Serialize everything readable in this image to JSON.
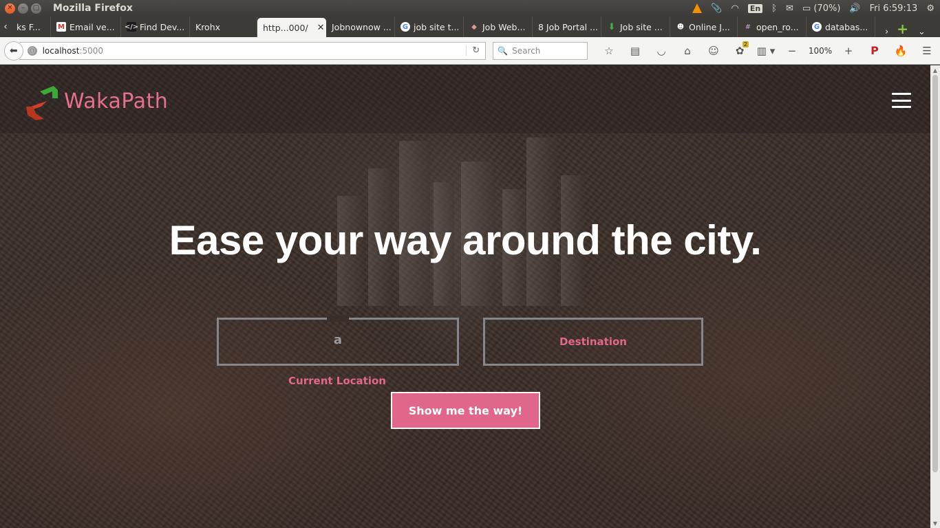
{
  "os": {
    "title": "Mozilla Firefox",
    "tray": {
      "lang": "En",
      "battery": "(70%)",
      "clock": "Fri  6:59:13"
    }
  },
  "tabs": [
    {
      "label": "ks F...",
      "icon": ""
    },
    {
      "label": "Email ve...",
      "icon": "gmail-icon"
    },
    {
      "label": "Find Dev...",
      "icon": "code-icon"
    },
    {
      "label": "Krohx",
      "icon": ""
    },
    {
      "label": "http...000/",
      "icon": "",
      "active": true
    },
    {
      "label": "Jobnownow ...",
      "icon": ""
    },
    {
      "label": "job site t...",
      "icon": "google-icon"
    },
    {
      "label": "Job Web...",
      "icon": "job-icon"
    },
    {
      "label": "8 Job Portal ...",
      "icon": ""
    },
    {
      "label": "Job site ...",
      "icon": "download-icon"
    },
    {
      "label": "Online J...",
      "icon": "owl-icon"
    },
    {
      "label": "open_ro...",
      "icon": "hash-icon"
    },
    {
      "label": "databas...",
      "icon": "google-icon"
    }
  ],
  "nav": {
    "url_host": "localhost",
    "url_port": ":5000",
    "search_placeholder": "Search",
    "zoom": "100%",
    "badge_count": "2"
  },
  "page": {
    "brand": "WakaPath",
    "hero_title": "Ease your way around the city.",
    "current_location_value": "a",
    "current_location_label": "Current Location",
    "destination_placeholder": "Destination",
    "cta_label": "Show me the way!"
  },
  "colors": {
    "accent": "#e0668a",
    "field_border": "#86868d",
    "logo_green": "#3aa935",
    "logo_red": "#d0402a"
  }
}
